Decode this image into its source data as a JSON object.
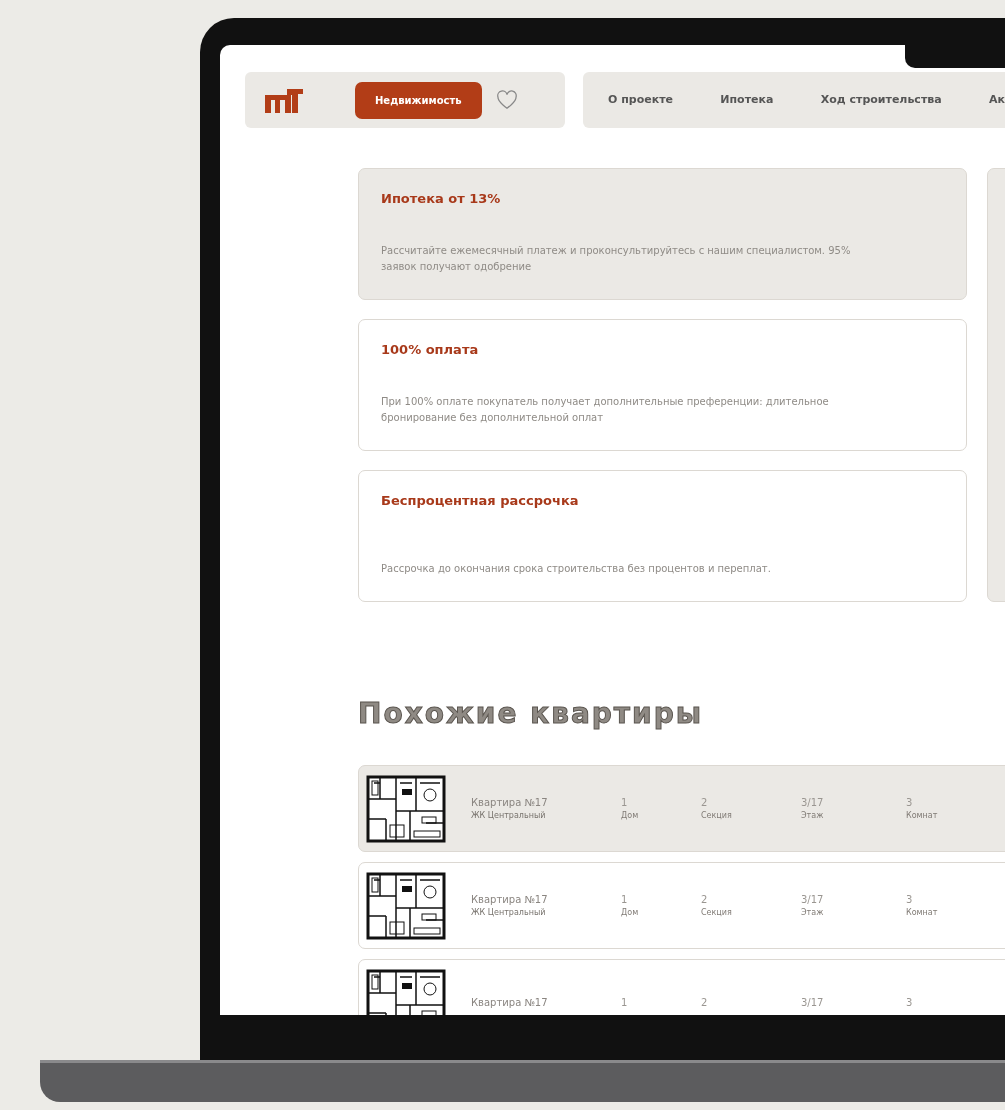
{
  "header": {
    "primary_button": "Недвижимость",
    "nav": [
      {
        "label": "О проекте"
      },
      {
        "label": "Ипотека"
      },
      {
        "label": "Ход строительства"
      },
      {
        "label": "Ак"
      }
    ]
  },
  "offers": [
    {
      "title": "Ипотека от 13%",
      "text": "Рассчитайте ежемесячный платеж и проконсультируйтесь с нашим специалистом. 95% заявок получают одобрение",
      "selected": true
    },
    {
      "title": "100% оплата",
      "text": "При 100% оплате покупатель получает дополнительные преференции: длительное бронирование без дополнительной оплат",
      "selected": false
    },
    {
      "title": "Беспроцентная рассрочка",
      "text": "Рассрочка до окончания срока строительства без процентов и переплат.",
      "selected": false
    }
  ],
  "similar": {
    "heading": "Похожие квартиры",
    "rows": [
      {
        "title": "Квартира №17",
        "subtitle": "ЖК Центральный",
        "selected": true,
        "fields": [
          {
            "value": "1",
            "label": "Дом"
          },
          {
            "value": "2",
            "label": "Секция"
          },
          {
            "value": "3/17",
            "label": "Этаж"
          },
          {
            "value": "3",
            "label": "Комнат"
          }
        ]
      },
      {
        "title": "Квартира №17",
        "subtitle": "ЖК Центральный",
        "selected": false,
        "fields": [
          {
            "value": "1",
            "label": "Дом"
          },
          {
            "value": "2",
            "label": "Секция"
          },
          {
            "value": "3/17",
            "label": "Этаж"
          },
          {
            "value": "3",
            "label": "Комнат"
          }
        ]
      },
      {
        "title": "Квартира №17",
        "selected": false,
        "fields": [
          {
            "value": "1"
          },
          {
            "value": "2"
          },
          {
            "value": "3/17"
          },
          {
            "value": "3"
          }
        ]
      }
    ]
  }
}
